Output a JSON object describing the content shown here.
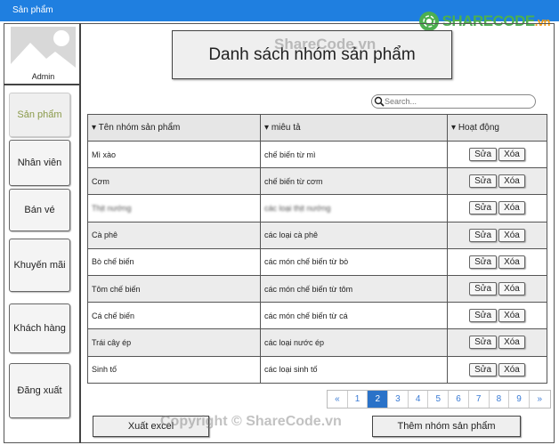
{
  "titlebar": {
    "title": "Sản phẩm"
  },
  "logo": {
    "text": "SHARECODE",
    "suffix": ".vn"
  },
  "watermark": {
    "top": "ShareCode.vn",
    "bottom": "Copyright © ShareCode.vn"
  },
  "sidebar": {
    "admin": "Admin",
    "items": [
      {
        "label": "Sản phẩm",
        "active": true
      },
      {
        "label": "Nhân viên"
      },
      {
        "label": "Bán vé"
      },
      {
        "label": "Khuyến mãi"
      },
      {
        "label": "Khách hàng"
      },
      {
        "label": "Đăng xuất"
      }
    ]
  },
  "header": {
    "title": "Danh sách nhóm sản phẩm"
  },
  "search": {
    "placeholder": "Search..."
  },
  "table": {
    "columns": [
      "Tên nhóm sản phẩm",
      "miêu tả",
      "Hoạt động"
    ],
    "edit_label": "Sửa",
    "delete_label": "Xóa",
    "rows": [
      [
        "Mì xào",
        "chế biến từ mì"
      ],
      [
        "Cơm",
        "chế biến từ cơm"
      ],
      [
        "Thịt nướng",
        "các loại thịt nướng"
      ],
      [
        "Cà phê",
        "các loại cà phê"
      ],
      [
        "Bò chế biến",
        "các món chế biến từ bò"
      ],
      [
        "Tôm chế biến",
        "các món chế biến từ tôm"
      ],
      [
        "Cá chế biến",
        "các món chế biến từ cá"
      ],
      [
        "Trái cây ép",
        "các loại nước ép"
      ],
      [
        "Sinh tố",
        "các loại sinh tố"
      ]
    ]
  },
  "pagination": {
    "prev": "«",
    "next": "»",
    "pages": [
      "1",
      "2",
      "3",
      "4",
      "5",
      "6",
      "7",
      "8",
      "9"
    ],
    "current": "2"
  },
  "actions": {
    "export": "Xuất excel",
    "add": "Thêm nhóm sản phẩm"
  }
}
